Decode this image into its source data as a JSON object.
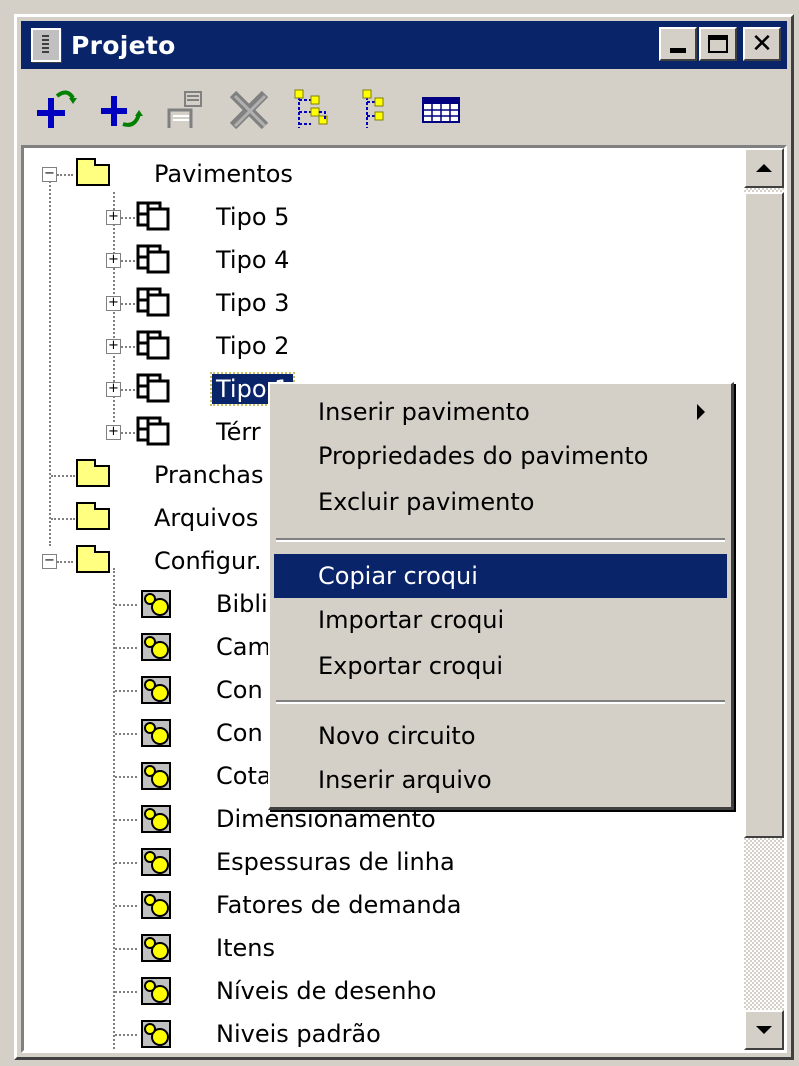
{
  "window": {
    "title": "Projeto"
  },
  "toolbar": {
    "buttons": [
      {
        "icon": "add-floor-icon"
      },
      {
        "icon": "add-item-icon"
      },
      {
        "icon": "copy-properties-icon"
      },
      {
        "icon": "delete-icon"
      },
      {
        "icon": "expand-tree-icon"
      },
      {
        "icon": "collapse-tree-icon"
      },
      {
        "icon": "table-icon"
      }
    ]
  },
  "tree": {
    "pavimentos": "Pavimentos",
    "floors": [
      "Tipo 5",
      "Tipo 4",
      "Tipo 3",
      "Tipo 2",
      "Tipo 1",
      "Térr"
    ],
    "pranchas": "Pranchas",
    "arquivos": "Arquivos",
    "configuracoes": "Configur.",
    "config_items": [
      "Biblio",
      "Cam",
      "Con",
      "Con",
      "Cota",
      "Dimensionamento",
      "Espessuras de linha",
      "Fatores de demanda",
      "Itens",
      "Níveis de desenho",
      "Niveis padrão"
    ]
  },
  "context_menu": {
    "items": [
      "Inserir pavimento",
      "Propriedades do pavimento",
      "Excluir pavimento",
      "Copiar croqui",
      "Importar croqui",
      "Exportar croqui",
      "Novo circuito",
      "Inserir arquivo"
    ],
    "highlighted": "Copiar croqui"
  },
  "colors": {
    "title_bar": "#0a246a",
    "face": "#d4d0c8",
    "folder": "#ffff80",
    "highlight": "#0a246a"
  }
}
